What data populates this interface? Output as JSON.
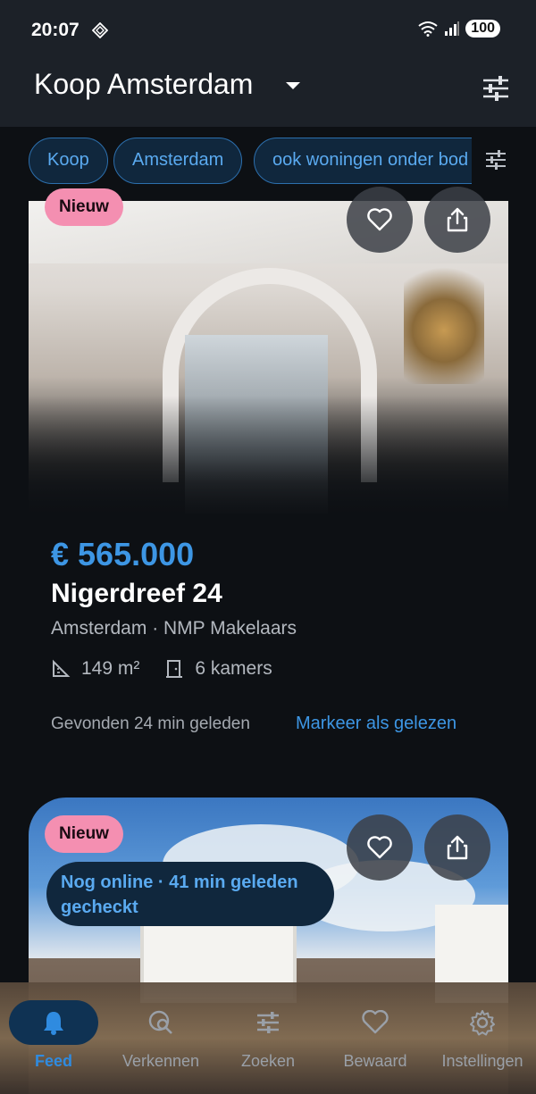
{
  "status_bar": {
    "time": "20:07",
    "battery": "100"
  },
  "app_bar": {
    "title": "Koop Amsterdam"
  },
  "filters": {
    "chips": [
      "Koop",
      "Amsterdam",
      "ook woningen onder bod"
    ]
  },
  "listings": [
    {
      "badge": "Nieuw",
      "price": "€ 565.000",
      "address": "Nigerdreef 24",
      "subtitle": "Amsterdam · NMP Makelaars",
      "area": "149 m²",
      "rooms": "6 kamers",
      "found": "Gevonden 24 min geleden",
      "mark_read": "Markeer als gelezen"
    },
    {
      "badge": "Nieuw",
      "status": "Nog online · 41 min geleden gecheckt"
    }
  ],
  "nav": {
    "items": [
      {
        "label": "Feed",
        "icon": "bell-icon",
        "active": true
      },
      {
        "label": "Verkennen",
        "icon": "explore-icon"
      },
      {
        "label": "Zoeken",
        "icon": "tune-icon"
      },
      {
        "label": "Bewaard",
        "icon": "heart-icon"
      },
      {
        "label": "Instellingen",
        "icon": "gear-icon"
      }
    ]
  },
  "colors": {
    "accent": "#3d96e4",
    "badge": "#f48fb1",
    "appbar": "#1c2128",
    "background": "#0d1014"
  }
}
